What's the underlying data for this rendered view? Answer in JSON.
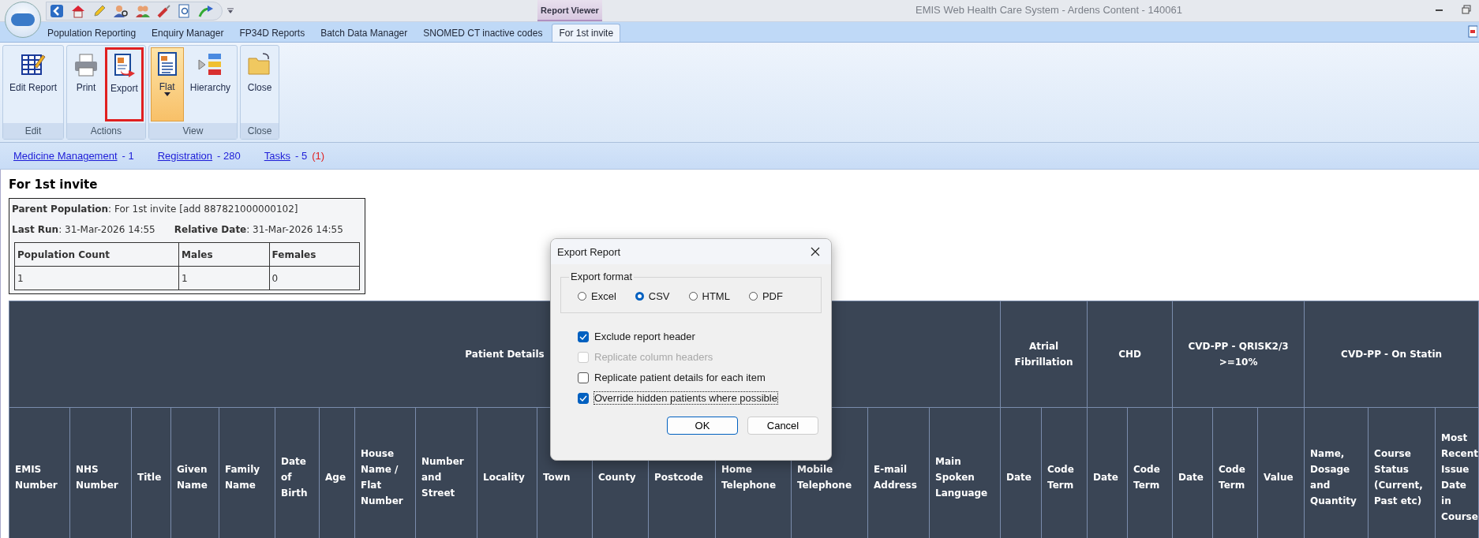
{
  "window": {
    "title": "EMIS Web Health Care System - Ardens Content - 140061"
  },
  "contextual_tab_group": {
    "label": "Report Viewer"
  },
  "tabs": [
    {
      "label": "Population Reporting",
      "selected": false
    },
    {
      "label": "Enquiry Manager",
      "selected": false
    },
    {
      "label": "FP34D Reports",
      "selected": false
    },
    {
      "label": "Batch Data Manager",
      "selected": false
    },
    {
      "label": "SNOMED CT inactive codes",
      "selected": false
    },
    {
      "label": "For 1st invite",
      "selected": true
    }
  ],
  "ribbon": {
    "groups": [
      {
        "label": "Edit",
        "buttons": [
          {
            "label": "Edit Report",
            "kind": "edit",
            "selected": false,
            "outlined": false
          }
        ]
      },
      {
        "label": "Actions",
        "buttons": [
          {
            "label": "Print",
            "kind": "print",
            "selected": false,
            "outlined": false
          },
          {
            "label": "Export",
            "kind": "export",
            "selected": false,
            "outlined": true
          }
        ]
      },
      {
        "label": "View",
        "buttons": [
          {
            "label": "Flat",
            "kind": "flat",
            "selected": true,
            "outlined": false
          },
          {
            "label": "Hierarchy",
            "kind": "hierarchy",
            "selected": false,
            "outlined": false
          }
        ]
      },
      {
        "label": "Close",
        "buttons": [
          {
            "label": "Close",
            "kind": "close",
            "selected": false,
            "outlined": false
          }
        ]
      }
    ]
  },
  "link_bar": {
    "items": [
      {
        "label": "Medicine Management",
        "count": "- 1"
      },
      {
        "label": "Registration",
        "count": "- 280"
      },
      {
        "label": "Tasks",
        "count": "- 5",
        "alert": "(1)"
      }
    ]
  },
  "report": {
    "title": "For 1st invite",
    "parent_population": "**Parent Population**: For 1st invite [add 887821000000102]",
    "last_run": "**Last Run**: 31-Mar-2026 14:55",
    "relative_date": "**Relative Date**: 31-Mar-2026 14:55",
    "counts": {
      "columns": [
        "Population Count",
        "Males",
        "Females"
      ],
      "rows": [
        [
          "1",
          "1",
          "0"
        ]
      ]
    },
    "table": {
      "groups": [
        {
          "label": "Patient Details",
          "columns": [
            "EMIS Number",
            "NHS Number",
            "Title",
            "Given Name",
            "Family Name",
            "Date of Birth",
            "Age",
            "House Name / Flat Number",
            "Number and Street",
            "Locality",
            "Town",
            "County",
            "Postcode",
            "Home Telephone",
            "Mobile Telephone",
            "E-mail Address",
            "Main Spoken Language"
          ]
        },
        {
          "label": "Atrial Fibrillation",
          "columns": [
            "Date",
            "Code Term"
          ]
        },
        {
          "label": "CHD",
          "columns": [
            "Date",
            "Code Term"
          ]
        },
        {
          "label": "CVD-PP - QRISK2/3 >=10%",
          "columns": [
            "Date",
            "Code Term",
            "Value"
          ]
        },
        {
          "label": "CVD-PP - On Statin",
          "columns": [
            "Name, Dosage and Quantity",
            "Course Status (Current, Past etc)",
            "Most Recent Issue Date in Course"
          ]
        }
      ]
    }
  },
  "dialog": {
    "title": "Export Report",
    "format": {
      "label": "Export format",
      "options": [
        {
          "label": "Excel",
          "selected": false
        },
        {
          "label": "CSV",
          "selected": true
        },
        {
          "label": "HTML",
          "selected": false
        },
        {
          "label": "PDF",
          "selected": false
        }
      ]
    },
    "options": [
      {
        "label": "Exclude report header",
        "checked": true,
        "disabled": false,
        "focused": false
      },
      {
        "label": "Replicate column headers",
        "checked": false,
        "disabled": true,
        "focused": false
      },
      {
        "label": "Replicate patient details for each item",
        "checked": false,
        "disabled": false,
        "focused": false
      },
      {
        "label": "Override hidden patients where possible",
        "checked": true,
        "disabled": false,
        "focused": true
      }
    ],
    "buttons": [
      {
        "label": "OK",
        "default": true
      },
      {
        "label": "Cancel",
        "default": false
      }
    ]
  }
}
